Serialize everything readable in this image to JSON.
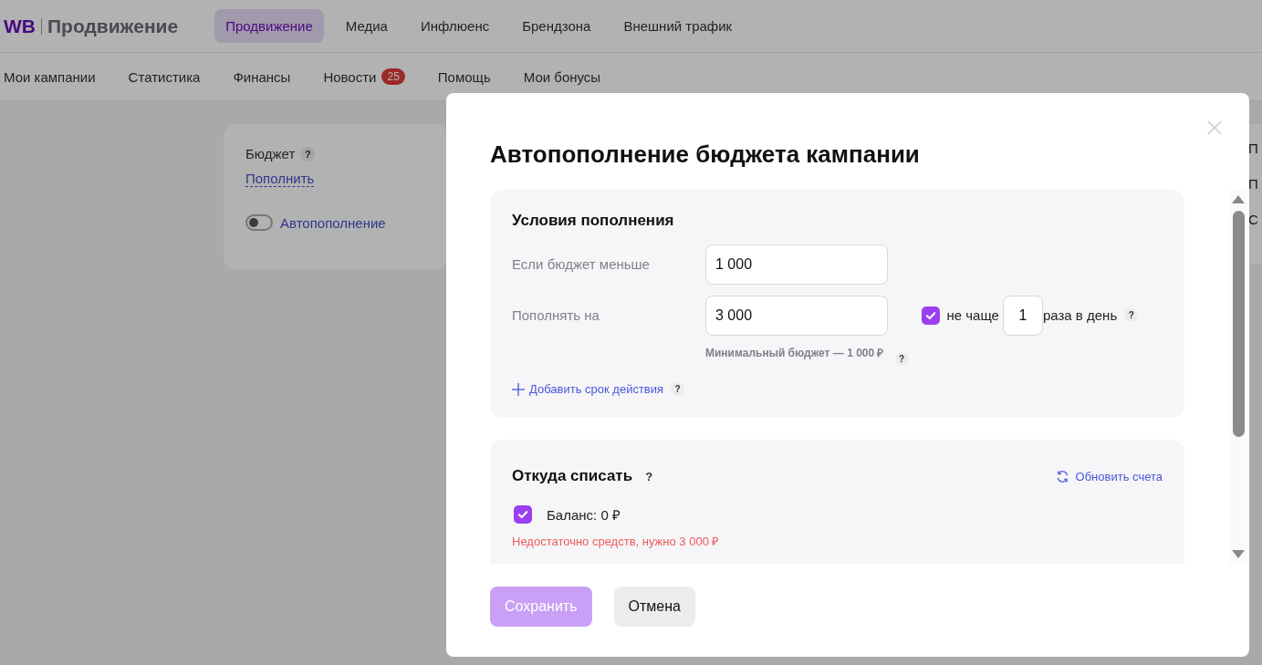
{
  "header": {
    "logo": "WB",
    "product": "Продвижение",
    "tabs": [
      {
        "label": "Продвижение",
        "selected": true
      },
      {
        "label": "Медиа",
        "selected": false
      },
      {
        "label": "Инфлюенс",
        "selected": false
      },
      {
        "label": "Брендзона",
        "selected": false
      },
      {
        "label": "Внешний трафик",
        "selected": false
      }
    ]
  },
  "subnav": [
    {
      "label": "Мои кампании"
    },
    {
      "label": "Статистика"
    },
    {
      "label": "Финансы"
    },
    {
      "label": "Новости",
      "badge": "25"
    },
    {
      "label": "Помощь"
    },
    {
      "label": "Мои бонусы"
    }
  ],
  "budget_card": {
    "label": "Бюджет",
    "help": "?",
    "link": "Пополнить",
    "autorefill": {
      "label": "Автопополнение",
      "on": false
    }
  },
  "side_card": {
    "lines": [
      "П",
      "П",
      "С"
    ]
  },
  "modal": {
    "title": "Автопополнение бюджета кампании",
    "conditions": {
      "title": "Условия пополнения",
      "threshold": {
        "label": "Если бюджет меньше",
        "value": "1 000"
      },
      "amount": {
        "label": "Пополнять на",
        "value": "3 000",
        "hint": "Минимальный бюджет — 1 000 ₽",
        "hint_help": "?"
      },
      "limit": {
        "checked": true,
        "prefix": "не чаще",
        "value": "1",
        "suffix": "раза в день",
        "help": "?"
      },
      "add_period": {
        "label": "Добавить срок действия",
        "help": "?"
      }
    },
    "source": {
      "title": "Откуда списать",
      "help": "?",
      "refresh": "Обновить счета",
      "accounts": [
        {
          "label": "Баланс: 0 ₽",
          "checked": true,
          "error": "Недостаточно средств, нужно 3 000 ₽"
        }
      ]
    },
    "buttons": [
      {
        "label": "Сохранить",
        "disabled": true
      },
      {
        "label": "Отмена",
        "disabled": false
      }
    ]
  }
}
